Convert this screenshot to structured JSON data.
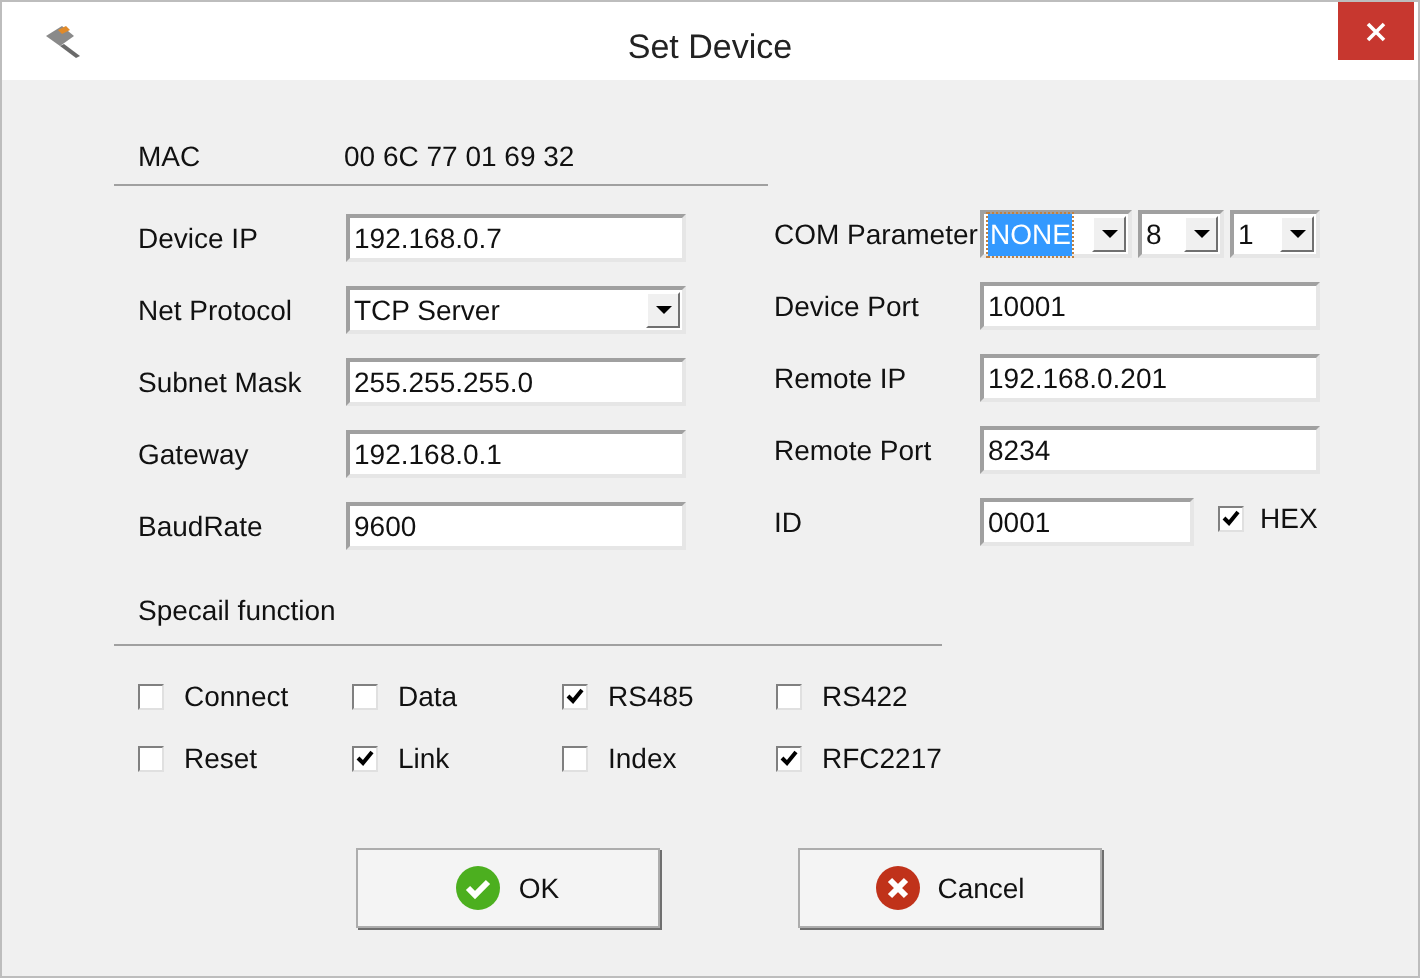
{
  "window": {
    "title": "Set Device"
  },
  "mac": {
    "label": "MAC",
    "value": "00 6C 77 01 69 32"
  },
  "left_fields": [
    {
      "label": "Device IP",
      "value": "192.168.0.7",
      "kind": "text"
    },
    {
      "label": "Net Protocol",
      "value": "TCP Server",
      "kind": "dropdown"
    },
    {
      "label": "Subnet Mask",
      "value": "255.255.255.0",
      "kind": "text"
    },
    {
      "label": "Gateway",
      "value": "192.168.0.1",
      "kind": "text"
    },
    {
      "label": "BaudRate",
      "value": "9600",
      "kind": "text"
    }
  ],
  "com_parameter": {
    "label": "COM Parameter",
    "selects": [
      {
        "value": "NONE",
        "focused": true
      },
      {
        "value": "8",
        "focused": false
      },
      {
        "value": "1",
        "focused": false
      }
    ]
  },
  "right_fields": [
    {
      "label": "Device Port",
      "value": "10001"
    },
    {
      "label": "Remote IP",
      "value": "192.168.0.201"
    },
    {
      "label": "Remote Port",
      "value": "8234"
    },
    {
      "label": "ID",
      "value": "0001"
    }
  ],
  "hex": {
    "label": "HEX",
    "checked": true
  },
  "special_function": {
    "title": "Specail function",
    "options": [
      {
        "label": "Connect",
        "checked": false
      },
      {
        "label": "Data",
        "checked": false
      },
      {
        "label": "RS485",
        "checked": true
      },
      {
        "label": "RS422",
        "checked": false
      },
      {
        "label": "Reset",
        "checked": false
      },
      {
        "label": "Link",
        "checked": true
      },
      {
        "label": "Index",
        "checked": false
      },
      {
        "label": "RFC2217",
        "checked": true
      }
    ]
  },
  "buttons": [
    {
      "label": "OK",
      "kind": "ok"
    },
    {
      "label": "Cancel",
      "kind": "cancel"
    }
  ]
}
